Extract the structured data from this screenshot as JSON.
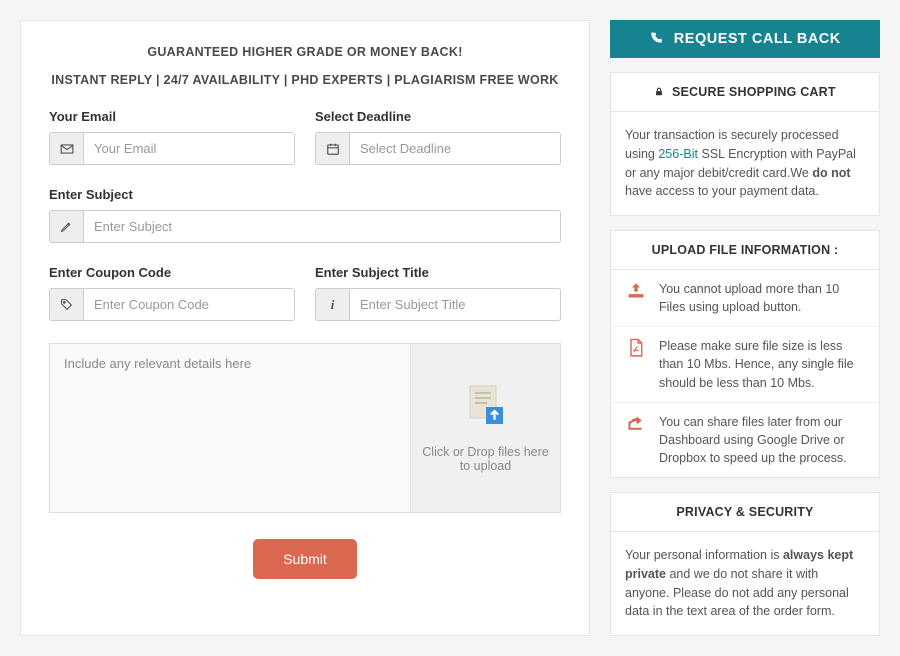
{
  "main": {
    "headline": "GUARANTEED HIGHER GRADE OR MONEY BACK!",
    "subheadline": "INSTANT REPLY | 24/7 AVAILABILITY | PHD EXPERTS | PLAGIARISM FREE WORK",
    "fields": {
      "email": {
        "label": "Your Email",
        "placeholder": "Your Email"
      },
      "deadline": {
        "label": "Select Deadline",
        "placeholder": "Select Deadline"
      },
      "subject": {
        "label": "Enter Subject",
        "placeholder": "Enter Subject"
      },
      "coupon": {
        "label": "Enter Coupon Code",
        "placeholder": "Enter Coupon Code"
      },
      "subject_title": {
        "label": "Enter Subject Title",
        "placeholder": "Enter Subject Title"
      },
      "details": {
        "placeholder": "Include any relevant details here"
      }
    },
    "upload_text": "Click or Drop files here to upload",
    "submit_label": "Submit"
  },
  "sidebar": {
    "call_back": "REQUEST CALL BACK",
    "secure": {
      "title": "SECURE SHOPPING CART",
      "text_pre": "Your transaction is securely processed using ",
      "ssl": "256-Bit",
      "text_mid": " SSL Encryption with PayPal or any major debit/credit card.We ",
      "bold": "do not",
      "text_post": " have access to your payment data."
    },
    "upload_info": {
      "title": "UPLOAD FILE INFORMATION :",
      "items": [
        "You cannot upload more than 10 Files using upload button.",
        "Please make sure file size is less than 10 Mbs. Hence, any single file should be less than 10 Mbs.",
        "You can share files later from our Dashboard using Google Drive or Dropbox to speed up the process."
      ]
    },
    "privacy": {
      "title": "PRIVACY & SECURITY",
      "text_pre": "Your personal information is ",
      "bold": "always kept private",
      "text_post": " and we do not share it with anyone. Please do not add any personal data in the text area of the order form."
    }
  }
}
